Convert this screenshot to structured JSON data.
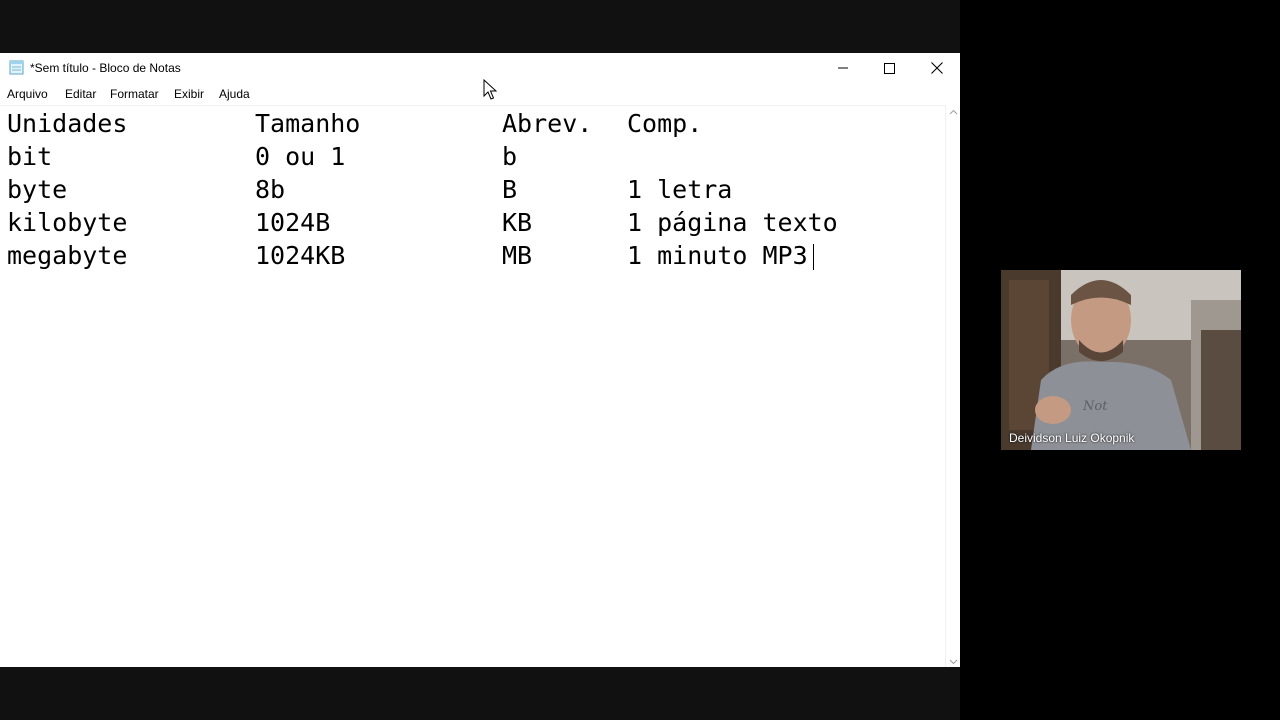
{
  "window": {
    "title": "*Sem título - Bloco de Notas"
  },
  "menu": {
    "items": [
      "Arquivo",
      "Editar",
      "Formatar",
      "Exibir",
      "Ajuda"
    ]
  },
  "document": {
    "rows": [
      [
        "Unidades",
        "Tamanho",
        "Abrev.",
        "Comp."
      ],
      [
        "bit",
        "0 ou 1",
        "b",
        ""
      ],
      [
        "byte",
        "8b",
        "B",
        "1 letra"
      ],
      [
        "kilobyte",
        "1024B",
        "KB",
        "1 página texto"
      ],
      [
        "megabyte",
        "1024KB",
        "MB",
        "1 minuto MP3"
      ]
    ]
  },
  "participant": {
    "name": "Deividson Luiz Okopnik"
  },
  "icons": {
    "app": "notepad-icon",
    "minimize": "minimize-icon",
    "maximize": "maximize-icon",
    "close": "close-icon",
    "cursor": "mouse-pointer-icon"
  },
  "colors": {
    "background": "#000000",
    "window": "#ffffff",
    "text": "#000000"
  }
}
